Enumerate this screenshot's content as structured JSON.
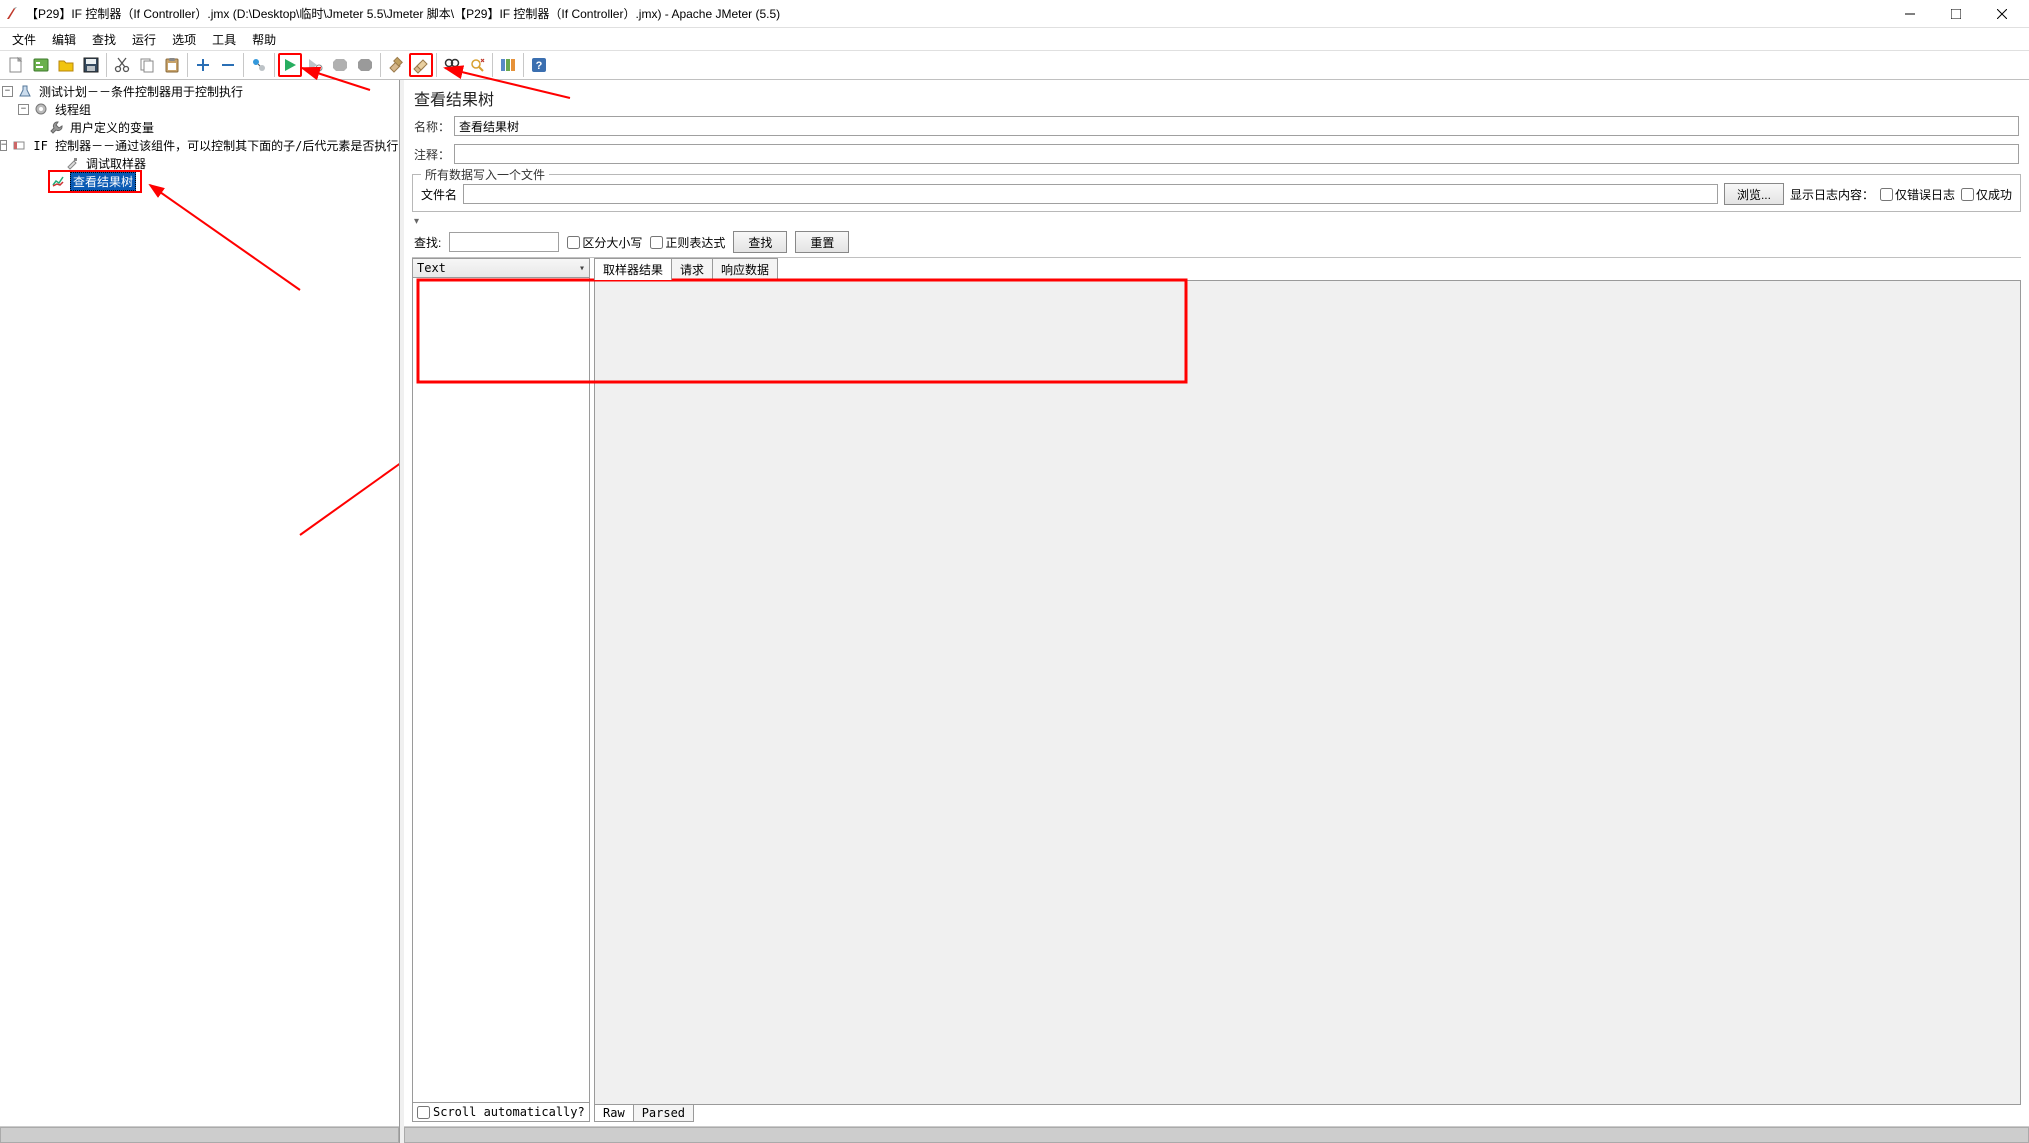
{
  "window": {
    "title": "【P29】IF 控制器（If Controller）.jmx (D:\\Desktop\\临时\\Jmeter 5.5\\Jmeter 脚本\\【P29】IF 控制器（If Controller）.jmx) - Apache JMeter (5.5)"
  },
  "menu": {
    "items": [
      "文件",
      "编辑",
      "查找",
      "运行",
      "选项",
      "工具",
      "帮助"
    ]
  },
  "toolbar": {
    "icons": [
      "new-icon",
      "templates-icon",
      "open-icon",
      "save-icon",
      "sep",
      "cut-icon",
      "copy-icon",
      "paste-icon",
      "sep",
      "expand-icon",
      "collapse-icon",
      "sep",
      "toggle-icon",
      "sep",
      "start-icon",
      "start-no-timers-icon",
      "stop-icon",
      "shutdown-icon",
      "sep",
      "clear-icon",
      "clear-all-icon",
      "sep",
      "search-icon",
      "reset-search-icon",
      "sep",
      "function-helper-icon",
      "sep",
      "help-icon"
    ]
  },
  "tree": {
    "root": {
      "label": "测试计划－－条件控制器用于控制执行"
    },
    "thread_group": {
      "label": "线程组"
    },
    "user_vars": {
      "label": "用户定义的变量"
    },
    "if_controller": {
      "label": "IF 控制器－－通过该组件，可以控制其下面的子/后代元素是否执行"
    },
    "debug_sampler": {
      "label": "调试取样器"
    },
    "view_results": {
      "label": "查看结果树"
    }
  },
  "panel": {
    "title": "查看结果树",
    "name_label": "名称：",
    "name_value": "查看结果树",
    "comment_label": "注释：",
    "comment_value": "",
    "file_group_title": "所有数据写入一个文件",
    "file_label": "文件名",
    "file_value": "",
    "browse_button": "浏览...",
    "log_content_label": "显示日志内容：",
    "only_error_label": "仅错误日志",
    "only_success_label": "仅成功",
    "search_label": "查找:",
    "search_value": "",
    "case_sensitive_label": "区分大小写",
    "regex_label": "正则表达式",
    "search_button": "查找",
    "reset_button": "重置",
    "dropdown_value": "Text",
    "tabs_top": [
      "取样器结果",
      "请求",
      "响应数据"
    ],
    "scroll_auto_label": "Scroll automatically?",
    "tabs_bottom": [
      "Raw",
      "Parsed"
    ]
  }
}
